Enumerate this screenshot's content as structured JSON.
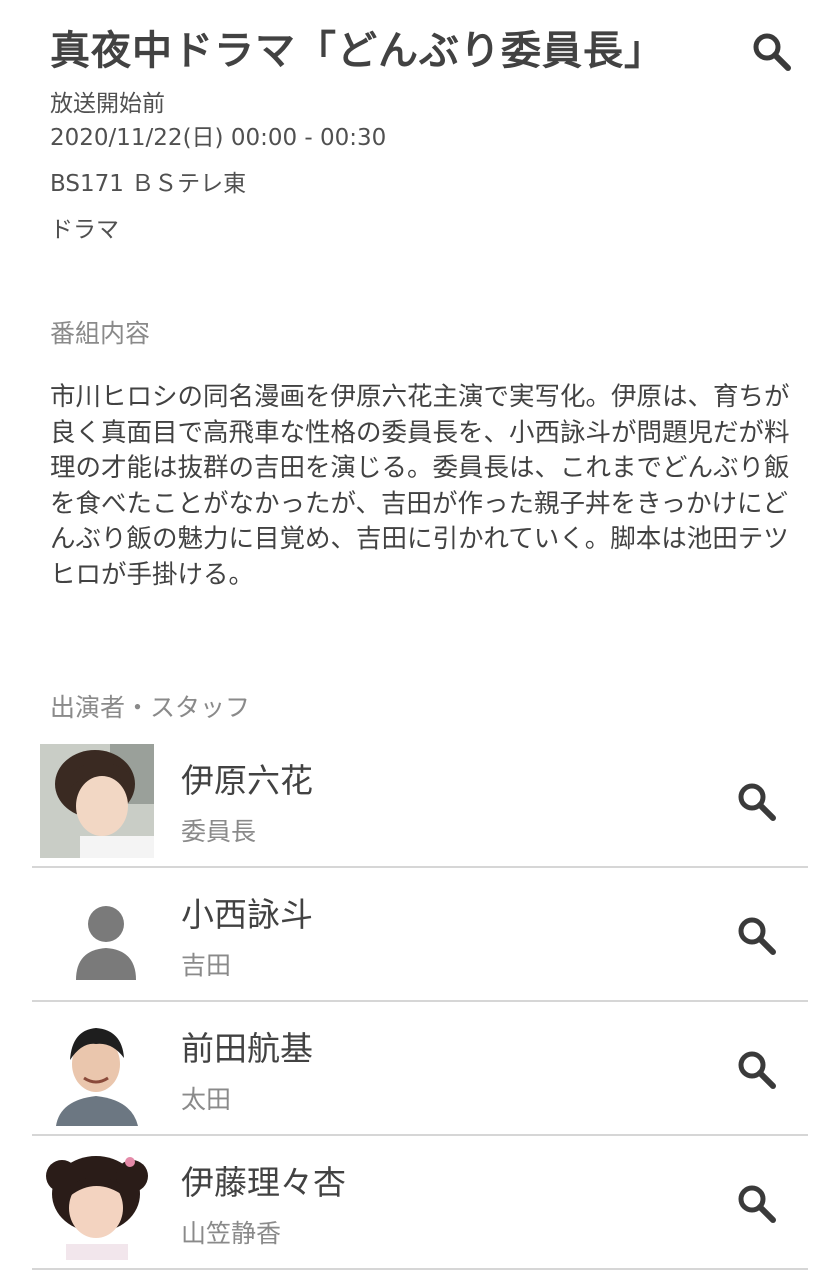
{
  "program": {
    "title": "真夜中ドラマ「どんぶり委員長」",
    "status": "放送開始前",
    "datetime": "2020/11/22(日) 00:00 - 00:30",
    "channel": "BS171 ＢＳテレ東",
    "genre": "ドラマ"
  },
  "content_section": {
    "label": "番組内容",
    "description": "市川ヒロシの同名漫画を伊原六花主演で実写化。伊原は、育ちが良く真面目で高飛車な性格の委員長を、小西詠斗が問題児だが料理の才能は抜群の吉田を演じる。委員長は、これまでどんぶり飯を食べたことがなかったが、吉田が作った親子丼をきっかけにどんぶり飯の魅力に目覚め、吉田に引かれていく。脚本は池田テツヒロが手掛ける。"
  },
  "cast_section": {
    "label": "出演者・スタッフ",
    "members": [
      {
        "name": "伊原六花",
        "role": "委員長",
        "avatar": "photo"
      },
      {
        "name": "小西詠斗",
        "role": "吉田",
        "avatar": "person-placeholder-icon"
      },
      {
        "name": "前田航基",
        "role": "太田",
        "avatar": "photo"
      },
      {
        "name": "伊藤理々杏",
        "role": "山笠静香",
        "avatar": "photo"
      }
    ]
  },
  "icons": {
    "search": "search-icon"
  },
  "colors": {
    "text": "#424242",
    "muted": "#8a8a8a",
    "divider": "#d6d6d6"
  }
}
